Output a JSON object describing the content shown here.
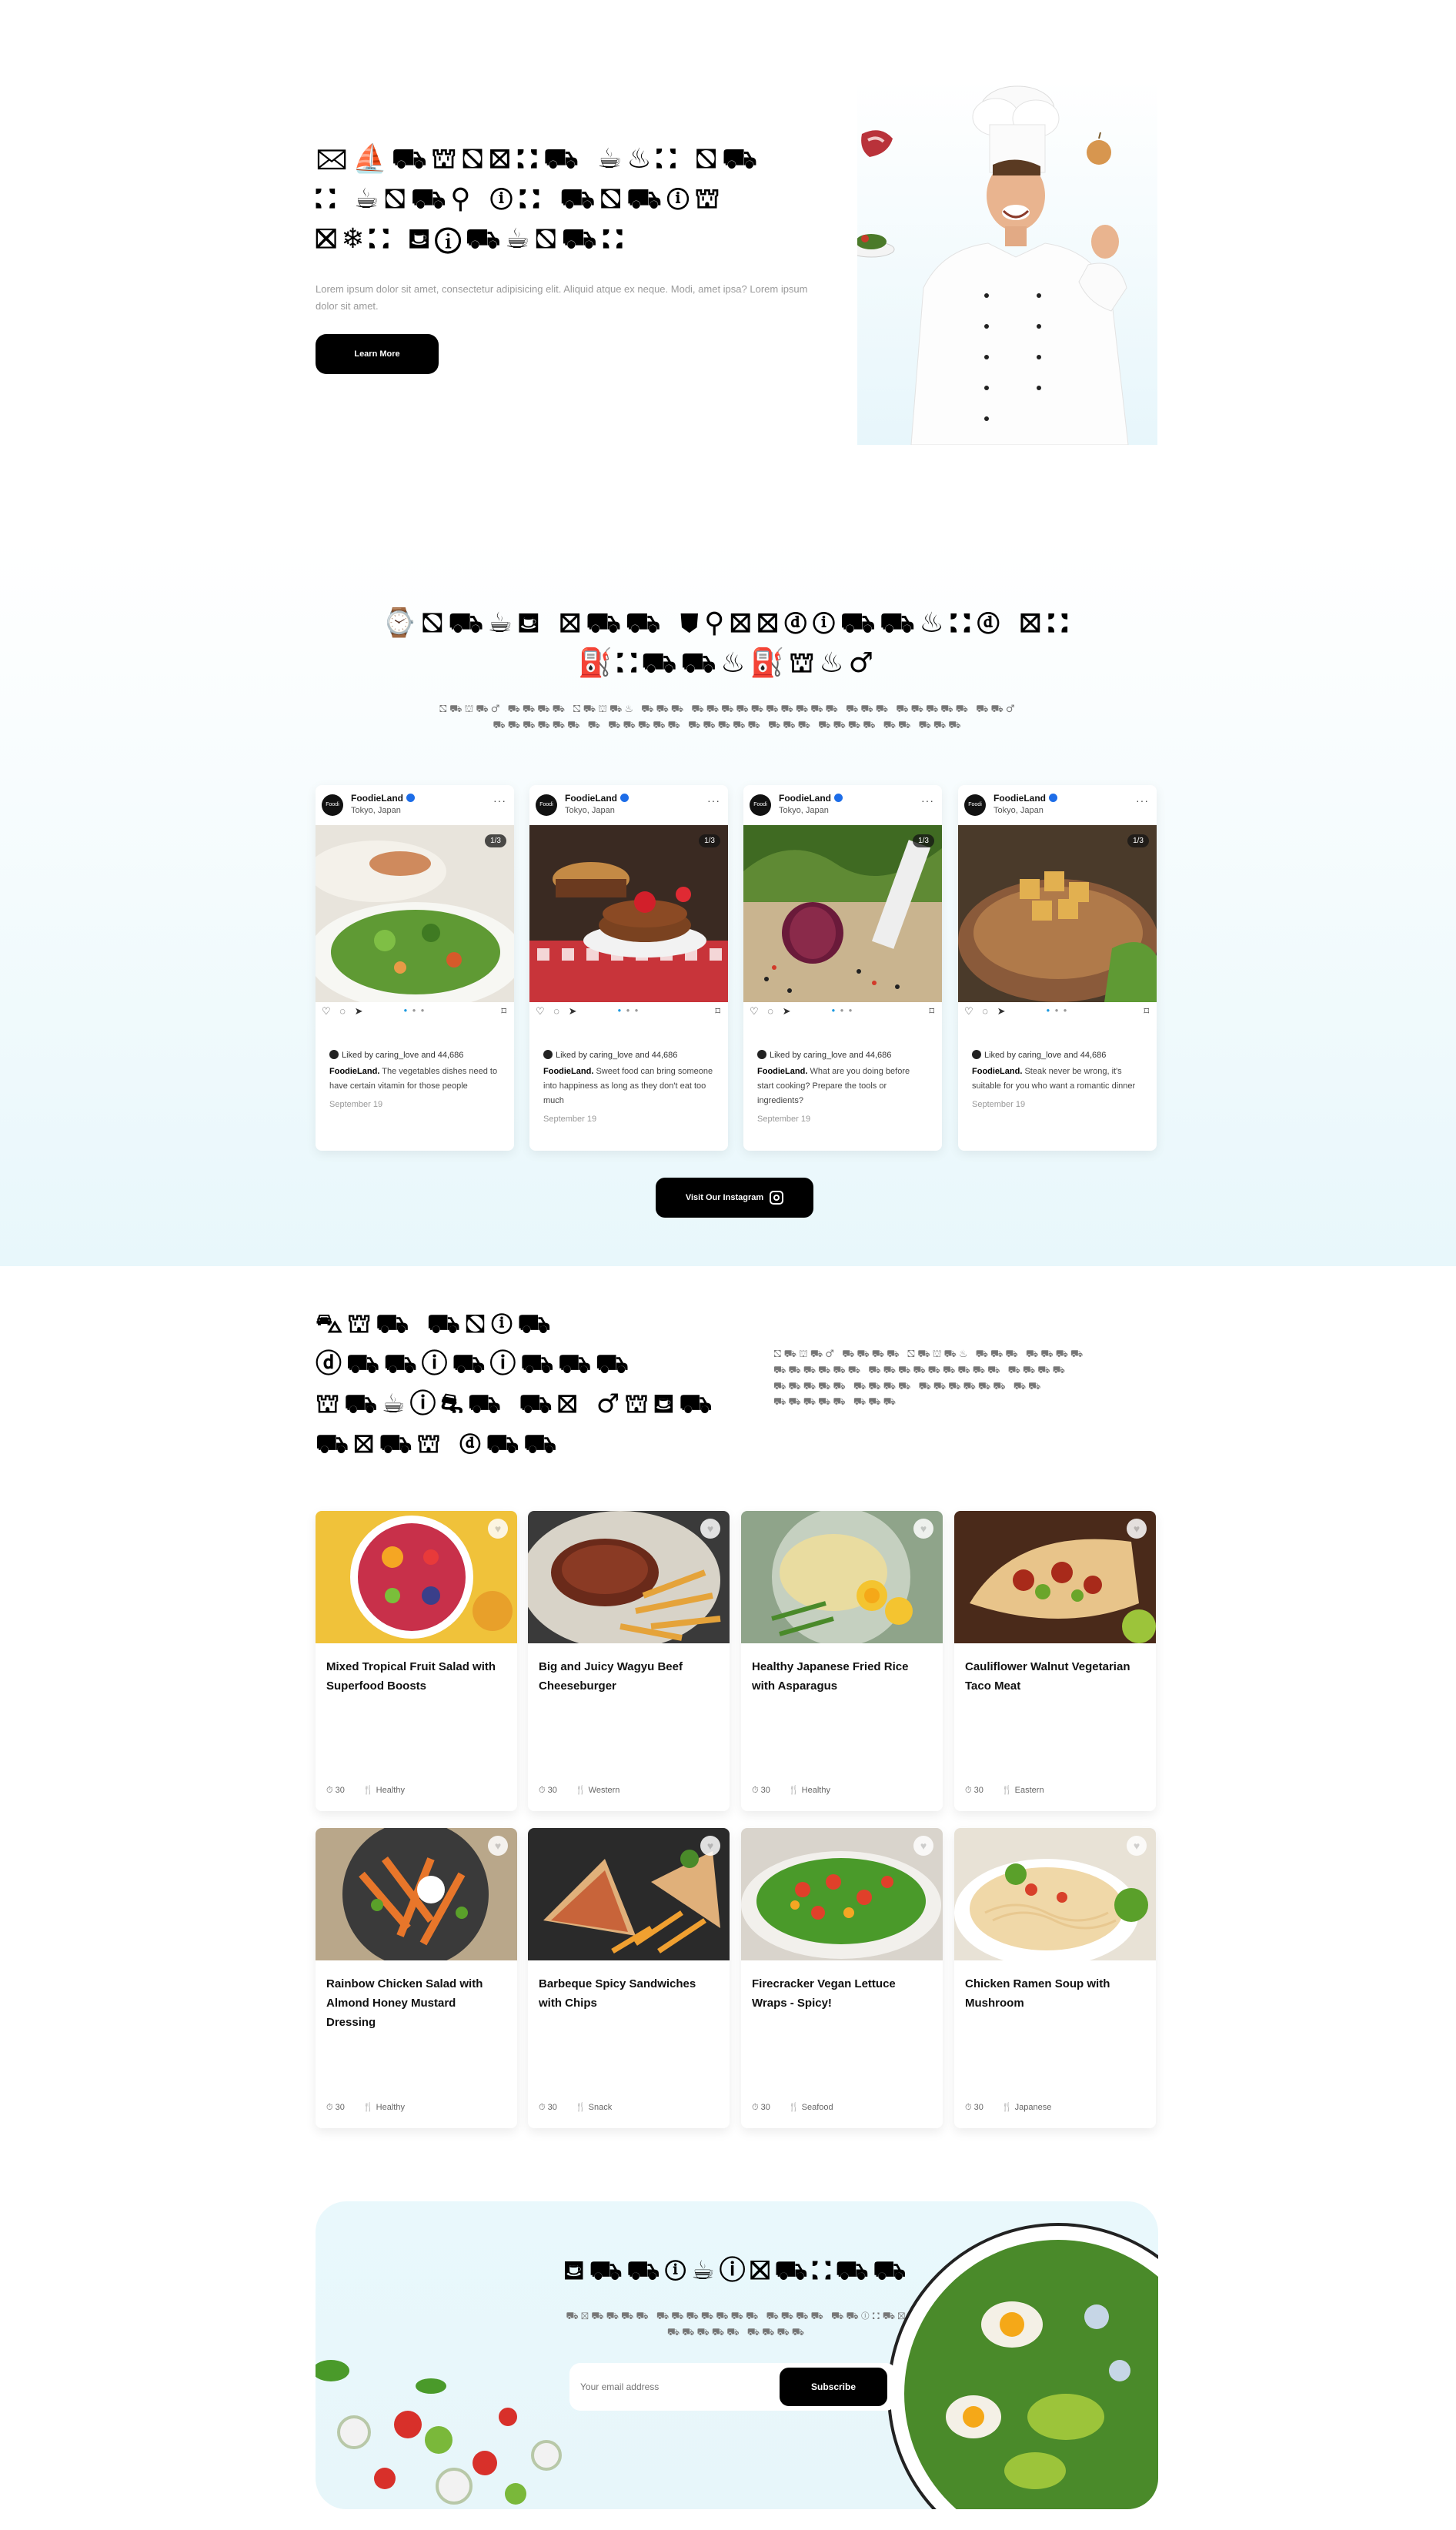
{
  "hero": {
    "title_lines": [
      "🖂⛵⛟⛫⛞⛝⛚⛟ ☕♨⛚ ⛞⛟",
      "⛚ ☕⛞⛟⚲ ⓘ⛚ ⛟⛞⛟ⓘ⛫",
      "⛝❄⛚ ⛾ⓘ⛟☕⛞⛟⛚"
    ],
    "description": "Lorem ipsum dolor sit amet, consectetur adipisicing elit. Aliquid atque ex neque. Modi, amet ipsa? Lorem ipsum dolor sit amet.",
    "button_label": "Learn More"
  },
  "instagram": {
    "title_lines": [
      "⌚⛞⛟☕⛾ ⛝⛟⛟ ⛊⚲⛝⛝ⓓⓘ⛟⛟♨⛚ⓓ ⛝⛚",
      "⛽⛚⛟⛟♨⛽⛫♨♂"
    ],
    "subtitle_lines": [
      "⛞⛟⛫⛟♂ ⛟⛟⛟⛟ ⛞⛟⛫⛟♨ ⛟⛟⛟ ⛟⛟⛟⛟⛟⛟⛟⛟⛟⛟ ⛟⛟⛟ ⛟⛟⛟⛟⛟ ⛟⛟♂",
      "⛟⛟⛟⛟⛟⛟ ⛟ ⛟⛟⛟⛟⛟ ⛟⛟⛟⛟⛟ ⛟⛟⛟ ⛟⛟⛟⛟ ⛟⛟ ⛟⛟⛟"
    ],
    "posts": [
      {
        "user": "FoodieLand",
        "location": "Tokyo, Japan",
        "counter": "1/3",
        "likes": "Liked by caring_love and 44,686",
        "caption_user": "FoodieLand.",
        "caption": "The vegetables dishes need to have certain vitamin for those people",
        "date": "September 19"
      },
      {
        "user": "FoodieLand",
        "location": "Tokyo, Japan",
        "counter": "1/3",
        "likes": "Liked by caring_love and 44,686",
        "caption_user": "FoodieLand.",
        "caption": "Sweet food can bring someone into happiness as long as they don't eat too much",
        "date": "September 19"
      },
      {
        "user": "FoodieLand",
        "location": "Tokyo, Japan",
        "counter": "1/3",
        "likes": "Liked by caring_love and 44,686",
        "caption_user": "FoodieLand.",
        "caption": "What are you doing before start cooking? Prepare the tools or ingredients?",
        "date": "September 19"
      },
      {
        "user": "FoodieLand",
        "location": "Tokyo, Japan",
        "counter": "1/3",
        "likes": "Liked by caring_love and 44,686",
        "caption_user": "FoodieLand.",
        "caption": "Steak never be wrong, it's suitable for you who want a romantic dinner",
        "date": "September 19"
      }
    ],
    "button_label": "Visit Our Instagram"
  },
  "recipes": {
    "title_lines": [
      "⛍⛫⛟ ⛟⛞ⓘ⛟",
      "ⓓ⛟⛟ⓘ⛟ⓘ⛟⛟⛟",
      "⛫⛟☕ⓘ⛐⛟ ⛟⛝ ♂⛫⛾⛟",
      "⛟⛝⛟⛫ ⓓ⛟⛟"
    ],
    "subtitle_lines": [
      "⛞⛟⛫⛟♂ ⛟⛟⛟⛟ ⛞⛟⛫⛟♨ ⛟⛟⛟ ⛟⛟⛟⛟",
      "⛟⛟⛟⛟⛟⛟ ⛟⛟⛟⛟⛟⛟⛟⛟⛟ ⛟⛟⛟⛟",
      "⛟⛟⛟⛟⛟ ⛟⛟⛟⛟ ⛟⛟⛟⛟⛟⛟ ⛟⛟",
      "⛟⛟⛟⛟⛟ ⛟⛟⛟"
    ],
    "items": [
      {
        "name": "Mixed Tropical Fruit Salad with Superfood Boosts",
        "time": "30",
        "category": "Healthy"
      },
      {
        "name": "Big and Juicy Wagyu Beef Cheeseburger",
        "time": "30",
        "category": "Western"
      },
      {
        "name": "Healthy Japanese Fried Rice with Asparagus",
        "time": "30",
        "category": "Healthy"
      },
      {
        "name": "Cauliflower Walnut Vegetarian Taco Meat",
        "time": "30",
        "category": "Eastern"
      },
      {
        "name": "Rainbow Chicken Salad with Almond Honey Mustard Dressing",
        "time": "30",
        "category": "Healthy"
      },
      {
        "name": "Barbeque Spicy Sandwiches with Chips",
        "time": "30",
        "category": "Snack"
      },
      {
        "name": "Firecracker Vegan Lettuce Wraps - Spicy!",
        "time": "30",
        "category": "Seafood"
      },
      {
        "name": "Chicken Ramen Soup with Mushroom",
        "time": "30",
        "category": "Japanese"
      }
    ]
  },
  "subscribe": {
    "title": "⛾⛟⛟ⓘ☕ⓘ⛝⛟⛚⛟⛟",
    "text_lines": [
      "⛟⛝⛟⛟⛟⛟ ⛟⛟⛟⛟⛟⛟⛟ ⛟⛟⛟⛟ ⛟⛟ⓘ⛚⛟⛝",
      "⛟⛟⛟⛟⛟ ⛟⛟⛟⛟"
    ],
    "placeholder": "Your email address",
    "button_label": "Subscribe"
  }
}
